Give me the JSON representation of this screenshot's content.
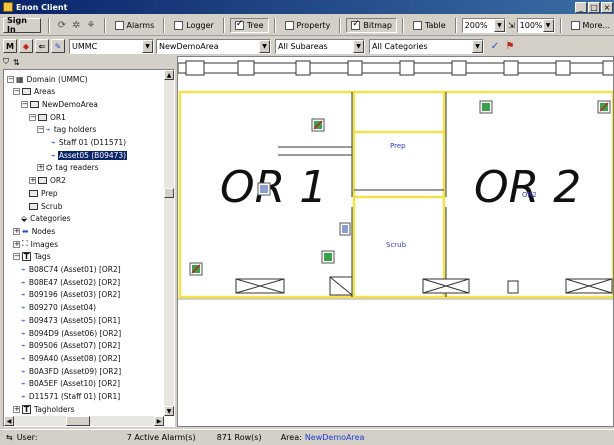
{
  "window": {
    "title": "Enon Client",
    "min": "_",
    "max": "□",
    "close": "×"
  },
  "toolbar1": {
    "signin_label": "Sign In",
    "alarms_label": "Alarms",
    "logger_label": "Logger",
    "tree_label": "Tree",
    "property_label": "Property",
    "bitmap_label": "Bitmap",
    "table_label": "Table",
    "zoom_value": "200%",
    "scale_value": "100%",
    "more_label": "More..."
  },
  "toolbar2": {
    "btn_m": "M",
    "domain_value": "UMMC",
    "area_value": "NewDemoArea",
    "subarea_value": "All Subareas",
    "category_value": "All Categories"
  },
  "tree": {
    "items": [
      {
        "label": "Domain (UMMC)",
        "icon": "domain",
        "exp": "−"
      },
      {
        "label": "Areas",
        "icon": "box",
        "exp": "−"
      },
      {
        "label": "NewDemoArea",
        "icon": "box",
        "exp": "−"
      },
      {
        "label": "OR1",
        "icon": "box",
        "exp": "−"
      },
      {
        "label": "tag holders",
        "icon": "tag",
        "exp": "−"
      },
      {
        "label": "Staff 01 (D11571)",
        "icon": "tag",
        "exp": ""
      },
      {
        "label": "Asset05 (B09473)",
        "icon": "tag",
        "exp": "",
        "selected": true
      },
      {
        "label": "tag readers",
        "icon": "reader",
        "exp": "+"
      },
      {
        "label": "OR2",
        "icon": "box",
        "exp": "+"
      },
      {
        "label": "Prep",
        "icon": "box",
        "exp": ""
      },
      {
        "label": "Scrub",
        "icon": "box",
        "exp": ""
      },
      {
        "label": "Categories",
        "icon": "cat",
        "exp": ""
      },
      {
        "label": "Nodes",
        "icon": "node",
        "exp": "+"
      },
      {
        "label": "Images",
        "icon": "img",
        "exp": "+"
      },
      {
        "label": "Tags",
        "icon": "t",
        "exp": "−"
      },
      {
        "label": "B08C74 (Asset01) [OR2]",
        "icon": "tag",
        "exp": ""
      },
      {
        "label": "B08E47 (Asset02) [OR2]",
        "icon": "tag",
        "exp": ""
      },
      {
        "label": "B09196 (Asset03) [OR2]",
        "icon": "tag",
        "exp": ""
      },
      {
        "label": "B09270 (Asset04)",
        "icon": "tag",
        "exp": ""
      },
      {
        "label": "B09473 (Asset05) [OR1]",
        "icon": "tag",
        "exp": ""
      },
      {
        "label": "B094D9 (Asset06) [OR2]",
        "icon": "tag",
        "exp": ""
      },
      {
        "label": "B09506 (Asset07) [OR2]",
        "icon": "tag",
        "exp": ""
      },
      {
        "label": "B09A40 (Asset08) [OR2]",
        "icon": "tag",
        "exp": ""
      },
      {
        "label": "B0A3FD (Asset09) [OR2]",
        "icon": "tag",
        "exp": ""
      },
      {
        "label": "B0A5EF (Asset10) [OR2]",
        "icon": "tag",
        "exp": ""
      },
      {
        "label": "D11571 (Staff 01) [OR1]",
        "icon": "tag",
        "exp": ""
      },
      {
        "label": "Tagholders",
        "icon": "t",
        "exp": "+"
      }
    ]
  },
  "map": {
    "room1_label": "OR 1",
    "room2_label": "OR 2",
    "prep_label": "Prep",
    "scrub_label": "Scrub",
    "or2_small_label": "OR2",
    "wall_color": "#f2e24a",
    "room_text_color": "#3a3ad0"
  },
  "status": {
    "user_label": "User:",
    "alarms_text": "7 Active Alarm(s)",
    "rows_text": "871 Row(s)",
    "area_label": "Area:",
    "area_value": "NewDemoArea"
  }
}
